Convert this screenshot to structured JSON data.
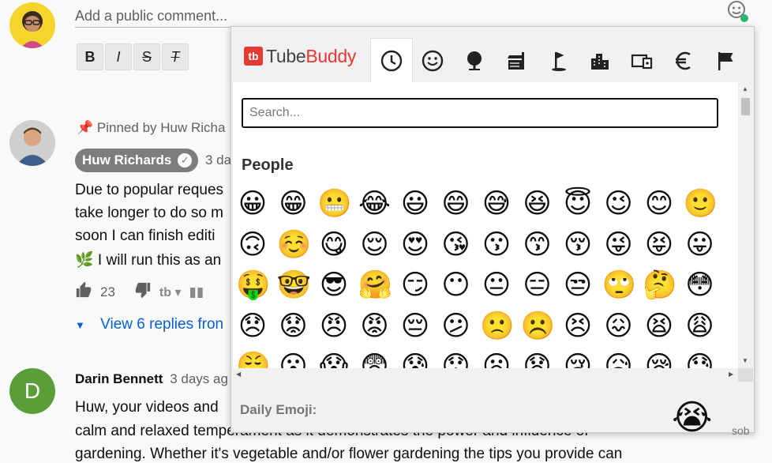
{
  "comment_box": {
    "placeholder": "Add a public comment...",
    "format_buttons": [
      "B",
      "I",
      "S",
      "T"
    ]
  },
  "pinned_comment": {
    "pinned_label": "Pinned by Huw Richa",
    "author": "Huw Richards",
    "date": "3 da",
    "lines": [
      "Due to popular reques",
      "take longer to do so m",
      "soon I can finish editi",
      "🌿 I will run this as an"
    ],
    "likes": "23",
    "view_replies": "View 6 replies fron"
  },
  "second_comment": {
    "author_initial": "D",
    "author": "Darin Bennett",
    "date": "3 days ag",
    "lines": [
      "Huw, your videos and",
      "calm and relaxed temperament as it demonstrates the power and influence of",
      "gardening.  Whether it's vegetable and/or flower gardening the tips you provide can"
    ]
  },
  "emoji_popup": {
    "brand_left": "Tube",
    "brand_right": "Buddy",
    "brand_mark": "tb",
    "tabs": [
      "clock-icon",
      "smiley-icon",
      "tree-icon",
      "food-icon",
      "golf-icon",
      "city-icon",
      "devices-icon",
      "euro-icon",
      "flag-icon"
    ],
    "search_placeholder": "Search...",
    "category": "People",
    "rows": [
      [
        "😀",
        "😁",
        "😬",
        "😂",
        "😃",
        "😄",
        "😅",
        "😆",
        "😇",
        "😉",
        "😊",
        "🙂"
      ],
      [
        "🙃",
        "☺️",
        "😋",
        "😌",
        "😍",
        "😘",
        "😗",
        "😙",
        "😚",
        "😜",
        "😝",
        "😛"
      ],
      [
        "🤑",
        "🤓",
        "😎",
        "🤗",
        "😏",
        "😶",
        "😐",
        "😑",
        "😒",
        "🙄",
        "🤔",
        "😳"
      ],
      [
        "😞",
        "😟",
        "😠",
        "😡",
        "😔",
        "😕",
        "🙁",
        "☹️",
        "😣",
        "😖",
        "😫",
        "😩"
      ],
      [
        "😤",
        "😮",
        "😱",
        "😨",
        "😰",
        "😯",
        "😦",
        "😧",
        "😢",
        "😥",
        "😪",
        "😓"
      ]
    ],
    "daily_label": "Daily Emoji:",
    "daily_emoji": "😭",
    "daily_name": "sob",
    "accent": "#e53935"
  }
}
